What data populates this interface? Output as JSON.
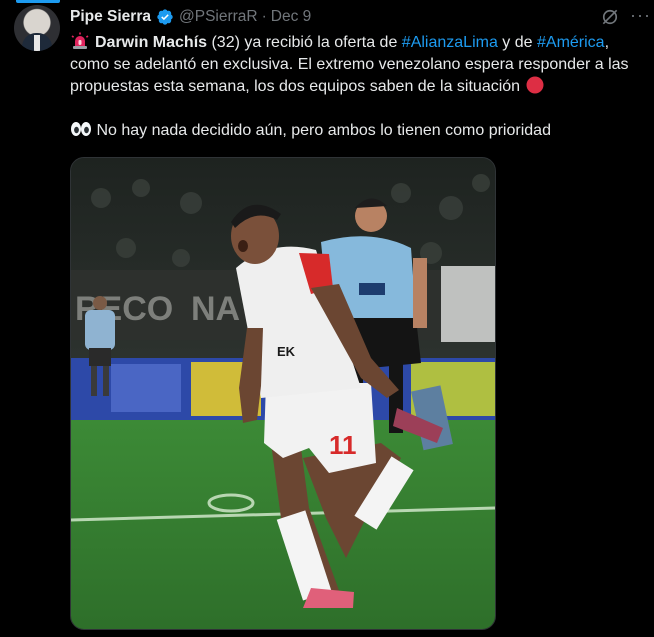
{
  "tweet": {
    "author_name": "Pipe Sierra",
    "handle": "@PSierraR",
    "separator": "·",
    "date": "Dec 9",
    "icons": {
      "verified": "verified-badge-icon",
      "grok": "grok-icon",
      "more": "more-icon",
      "siren": "siren-emoji",
      "red_circle": "red-circle-emoji",
      "eyes": "eyes-emoji"
    },
    "body": {
      "player_name": "Darwin Machís",
      "seg1": " (32) ya recibió la oferta de ",
      "hashtag1": "#AlianzaLima",
      "seg2": " y de ",
      "hashtag2": "#América",
      "seg3": ", como se adelantó en exclusiva. El extremo venezolano espera responder a las propuestas esta semana, los dos equipos saben de la situación ",
      "line2": " No hay nada decidido aún, pero ambos lo tienen como prioridad"
    },
    "media": {
      "description_icon": "soccer-player-photo",
      "jersey_number": "11",
      "sponsor_text": "EK"
    }
  },
  "colors": {
    "background": "#000000",
    "text": "#e7e9ea",
    "muted": "#71767b",
    "link": "#1d9bf0",
    "verified": "#1d9bf0"
  }
}
